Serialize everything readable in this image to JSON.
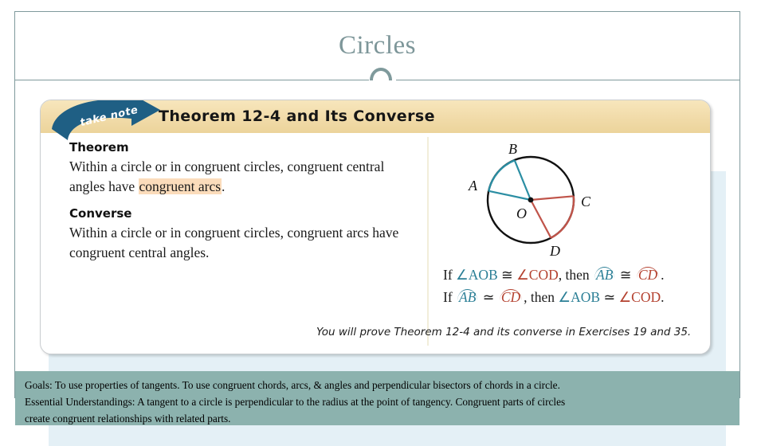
{
  "slide": {
    "title": "Circles",
    "accent_color": "#7f9a9c",
    "title_color": "#7d9699",
    "backdrop_color": "#e4f0f6"
  },
  "theorem_card": {
    "ribbon_label": "take note",
    "header_title": "Theorem 12-4 and Its Converse",
    "header_bg": "#f1dba9",
    "ribbon_bg": "#1f5f84",
    "theorem": {
      "heading": "Theorem",
      "text_before": "Within a circle or in congruent circles, congruent central angles have ",
      "highlight": "congruent arcs",
      "text_after": ".",
      "highlight_color": "#fbdcbb"
    },
    "converse": {
      "heading": "Converse",
      "text": "Within a circle or in congruent circles, congruent arcs have congruent central angles."
    },
    "statements": [
      {
        "lead": "If",
        "left_angle": "∠AOB",
        "rel1": "≅",
        "right_angle": "∠COD",
        "mid": ", then",
        "left_arc": "AB",
        "rel2": "≅",
        "right_arc": "CD",
        "tail": "."
      },
      {
        "lead": "If",
        "left_arc": "AB",
        "rel1": "≃",
        "right_arc": "CD",
        "mid": ", then",
        "left_angle": "∠AOB",
        "rel2": "≃",
        "right_angle": "∠COD",
        "tail": "."
      }
    ],
    "footer_note": "You will prove Theorem 12-4 and its converse in Exercises 19 and 35.",
    "diagram": {
      "center_label": "O",
      "point_labels": [
        "A",
        "B",
        "C",
        "D"
      ],
      "teal_color": "#2b8ea3",
      "red_color": "#c0544a",
      "circle_color": "#111111"
    }
  },
  "goals_banner": {
    "bg_color": "#8cb2ae",
    "lines": [
      "Goals: To use properties of tangents.  To use congruent chords, arcs, & angles and perpendicular bisectors of chords in a circle.",
      "Essential Understandings:  A tangent to a circle is perpendicular to the radius at the point of tangency.  Congruent parts of circles",
      "create congruent relationships with related parts."
    ]
  }
}
